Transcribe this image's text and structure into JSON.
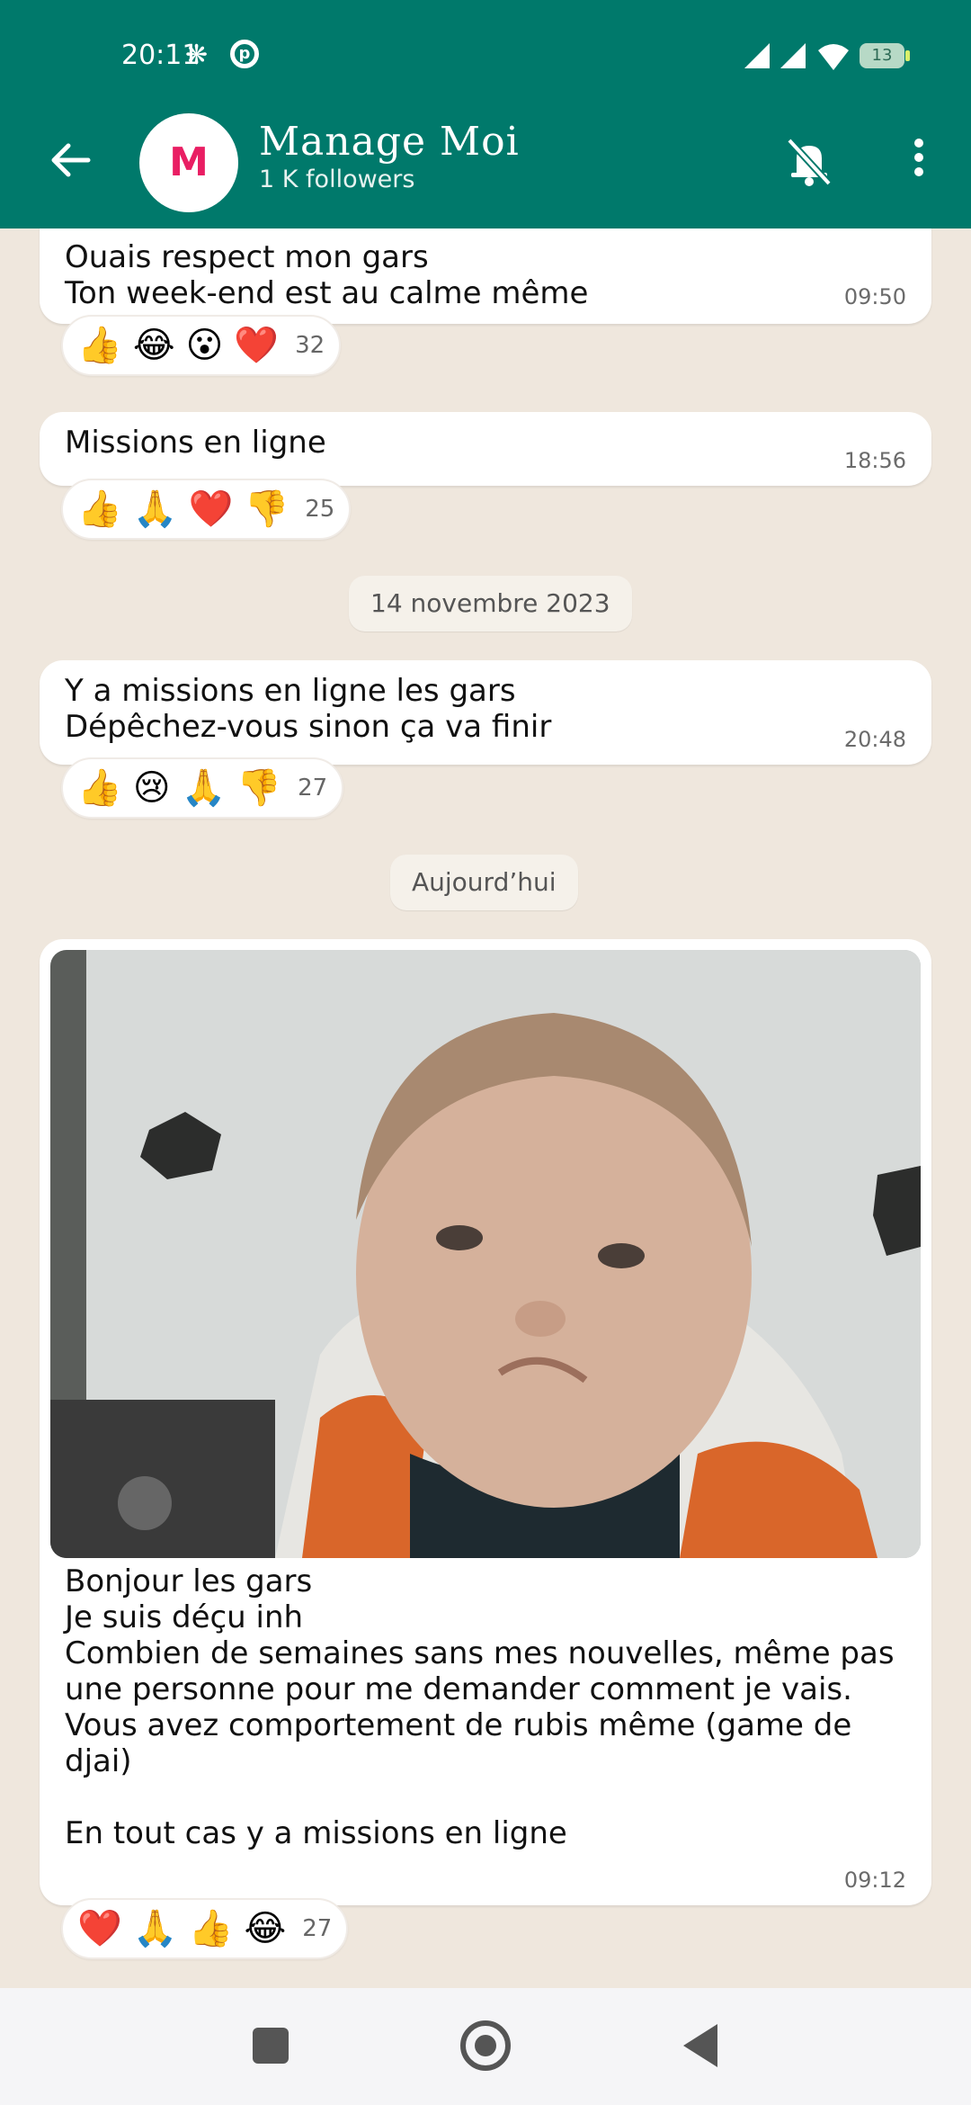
{
  "status_bar": {
    "time": "20:11",
    "battery": "13"
  },
  "channel": {
    "name": "Manage Moi",
    "followers": "1 K followers",
    "logo_letter": "M"
  },
  "messages": [
    {
      "text": "Ouais respect mon gars\nTon week-end est au calme même",
      "time": "09:50",
      "reactions": [
        "👍",
        "😂",
        "😮",
        "❤️"
      ],
      "reaction_count": "32"
    },
    {
      "text": "Missions en ligne",
      "time": "18:56",
      "reactions": [
        "👍",
        "🙏",
        "❤️",
        "👎"
      ],
      "reaction_count": "25"
    },
    {
      "text": "Y a missions en ligne les gars\nDépêchez-vous sinon ça va finir",
      "time": "20:48",
      "reactions": [
        "👍",
        "😢",
        "🙏",
        "👎"
      ],
      "reaction_count": "27"
    },
    {
      "text": "Bonjour les gars\nJe suis déçu inh\nCombien de semaines sans mes nouvelles, même pas une personne pour me demander comment je vais.\nVous avez comportement de rubis même (game de djai)\n\nEn tout cas y a missions en ligne",
      "time": "09:12",
      "reactions": [
        "❤️",
        "🙏",
        "👍",
        "😂"
      ],
      "reaction_count": "27"
    }
  ],
  "date_chips": {
    "first": "14 novembre 2023",
    "second": "Aujourd’hui"
  },
  "icons": {
    "back": "arrow-left-icon",
    "mute": "bell-off-icon",
    "menu": "more-vertical-icon",
    "nav_recent": "square-icon",
    "nav_home": "circle-icon",
    "nav_back": "triangle-back-icon"
  },
  "colors": {
    "header": "#00796b",
    "chat_bg": "#efe7dd",
    "bubble": "#ffffff"
  }
}
